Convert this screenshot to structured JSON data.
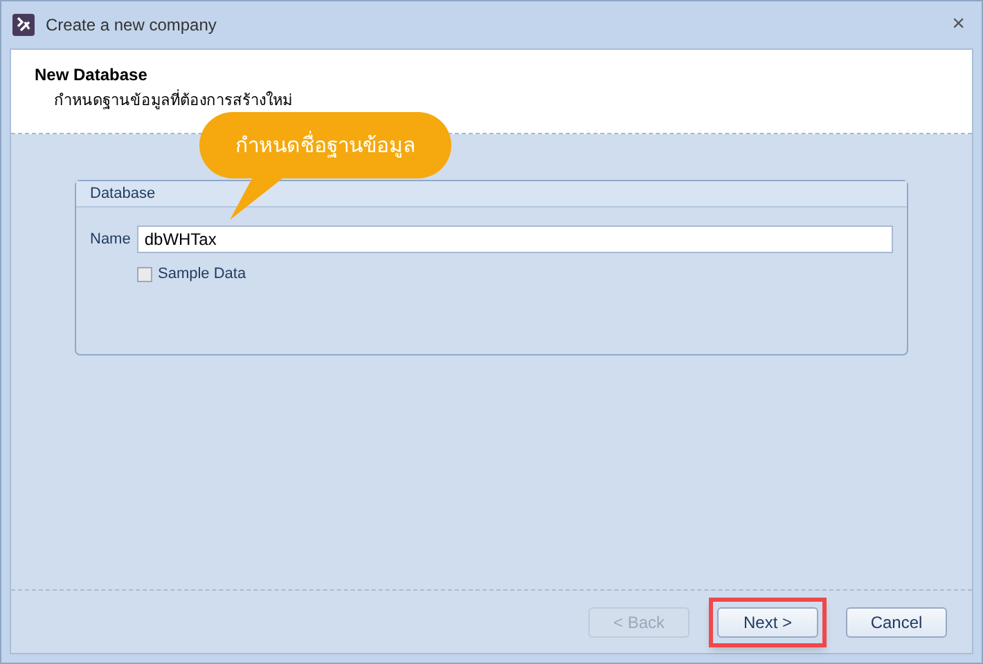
{
  "window": {
    "title": "Create a new company",
    "close": "×"
  },
  "header": {
    "title": "New Database",
    "subtitle": "กำหนดฐานข้อมูลที่ต้องการสร้างใหม่"
  },
  "callout": {
    "text": "กำหนดชื่อฐานข้อมูล"
  },
  "group": {
    "title": "Database",
    "name_label": "Name",
    "name_value": "dbWHTax",
    "sample_data": {
      "label": "Sample Data",
      "checked": false
    }
  },
  "buttons": [
    {
      "label": "< Back",
      "disabled": true,
      "highlighted": false
    },
    {
      "label": "Next >",
      "disabled": false,
      "highlighted": true
    },
    {
      "label": "Cancel",
      "disabled": false,
      "highlighted": false
    }
  ]
}
